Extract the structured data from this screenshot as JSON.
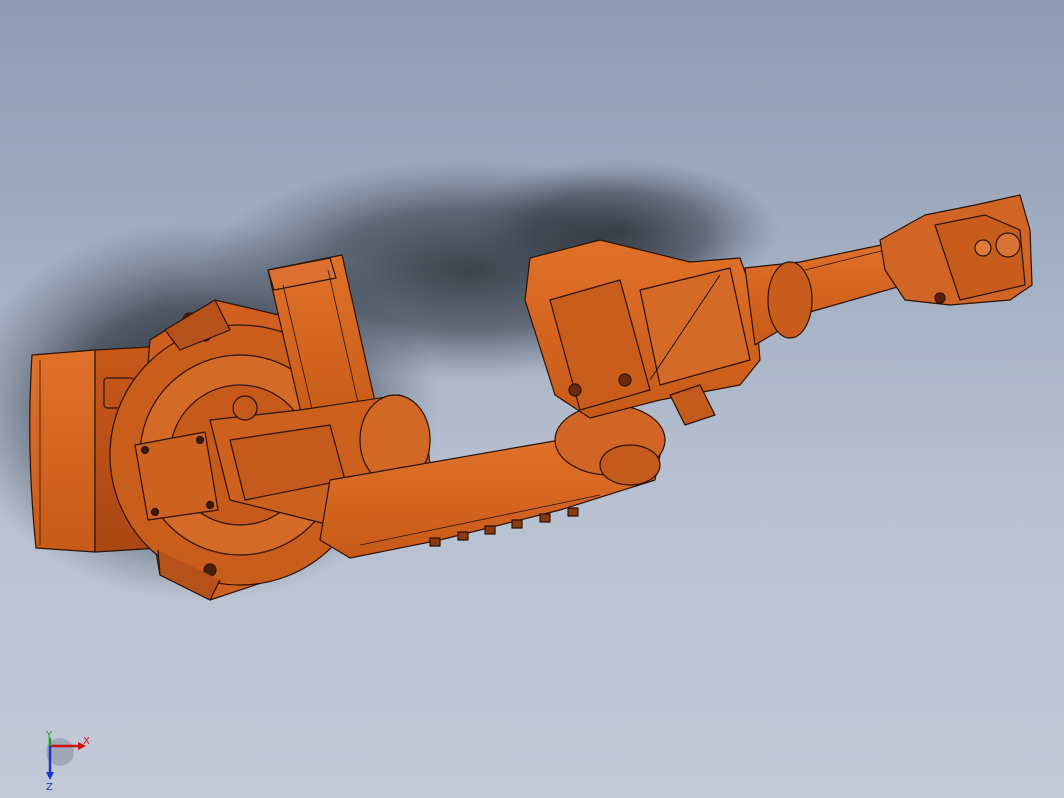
{
  "viewport": {
    "background_top": "#8e9bb1",
    "background_bottom": "#c2cad8",
    "model": {
      "name": "robot-arm",
      "color": "#d2641c",
      "edge_color": "#2b1206",
      "shadow_color": "#1c2128"
    }
  },
  "triad": {
    "x_label": "X",
    "y_label": "Y",
    "z_label": "Z",
    "x_color": "#d01010",
    "y_color": "#17a017",
    "z_color": "#1536c8"
  }
}
